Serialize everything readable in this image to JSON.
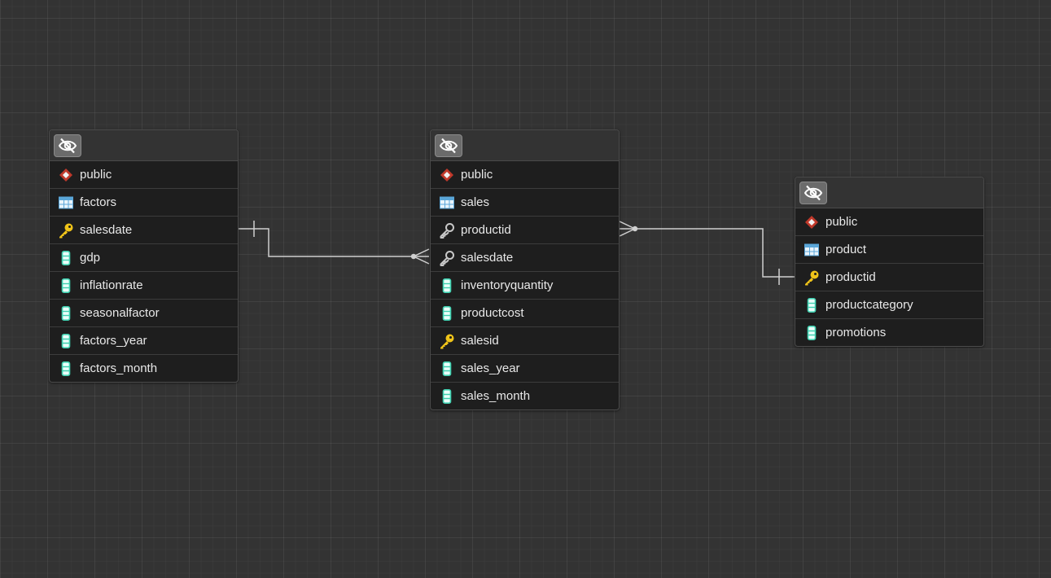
{
  "colors": {
    "background": "#333333",
    "node_body": "#1e1e1e",
    "edge": "#d0d0d0",
    "schema_icon": "#c0392b",
    "table_icon": "#5aa6d8",
    "key_icon": "#f0c419",
    "foreign_key_icon": "#c8c8c8",
    "column_icon": "#3fd0b0"
  },
  "tables": [
    {
      "schema": "public",
      "name": "factors",
      "columns": [
        {
          "name": "salesdate",
          "icon": "primary-key-icon"
        },
        {
          "name": "gdp",
          "icon": "column-icon"
        },
        {
          "name": "inflationrate",
          "icon": "column-icon"
        },
        {
          "name": "seasonalfactor",
          "icon": "column-icon"
        },
        {
          "name": "factors_year",
          "icon": "column-icon"
        },
        {
          "name": "factors_month",
          "icon": "column-icon"
        }
      ]
    },
    {
      "schema": "public",
      "name": "sales",
      "columns": [
        {
          "name": "productid",
          "icon": "foreign-key-icon"
        },
        {
          "name": "salesdate",
          "icon": "foreign-key-icon"
        },
        {
          "name": "inventoryquantity",
          "icon": "column-icon"
        },
        {
          "name": "productcost",
          "icon": "column-icon"
        },
        {
          "name": "salesid",
          "icon": "primary-key-icon"
        },
        {
          "name": "sales_year",
          "icon": "column-icon"
        },
        {
          "name": "sales_month",
          "icon": "column-icon"
        }
      ]
    },
    {
      "schema": "public",
      "name": "product",
      "columns": [
        {
          "name": "productid",
          "icon": "primary-key-icon"
        },
        {
          "name": "productcategory",
          "icon": "column-icon"
        },
        {
          "name": "promotions",
          "icon": "column-icon"
        }
      ]
    }
  ],
  "relations": [
    {
      "from": "factors.salesdate",
      "to": "sales.salesdate",
      "from_cardinality": "one",
      "to_cardinality": "many"
    },
    {
      "from": "product.productid",
      "to": "sales.productid",
      "from_cardinality": "one",
      "to_cardinality": "many"
    }
  ]
}
